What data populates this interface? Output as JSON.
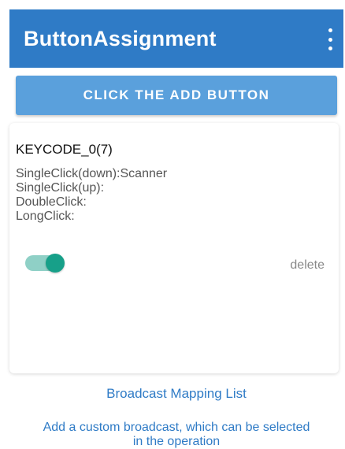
{
  "app_bar": {
    "title": "ButtonAssignment",
    "overflow_icon": "more-vert-icon"
  },
  "add_button": {
    "label": "CLICK THE ADD BUTTON"
  },
  "mapping_card": {
    "keycode": "KEYCODE_0(7)",
    "lines": [
      "SingleClick(down):Scanner",
      "SingleClick(up):",
      "DoubleClick:",
      "LongClick:"
    ],
    "enabled": true,
    "delete_label": "delete"
  },
  "broadcast": {
    "link_label": "Broadcast Mapping List",
    "hint_lines": [
      "Add a custom broadcast, which can be selected",
      "in the operation"
    ]
  },
  "colors": {
    "primary": "#2f7bc6",
    "button": "#5aa0dc",
    "switch_on": "#17a089"
  }
}
